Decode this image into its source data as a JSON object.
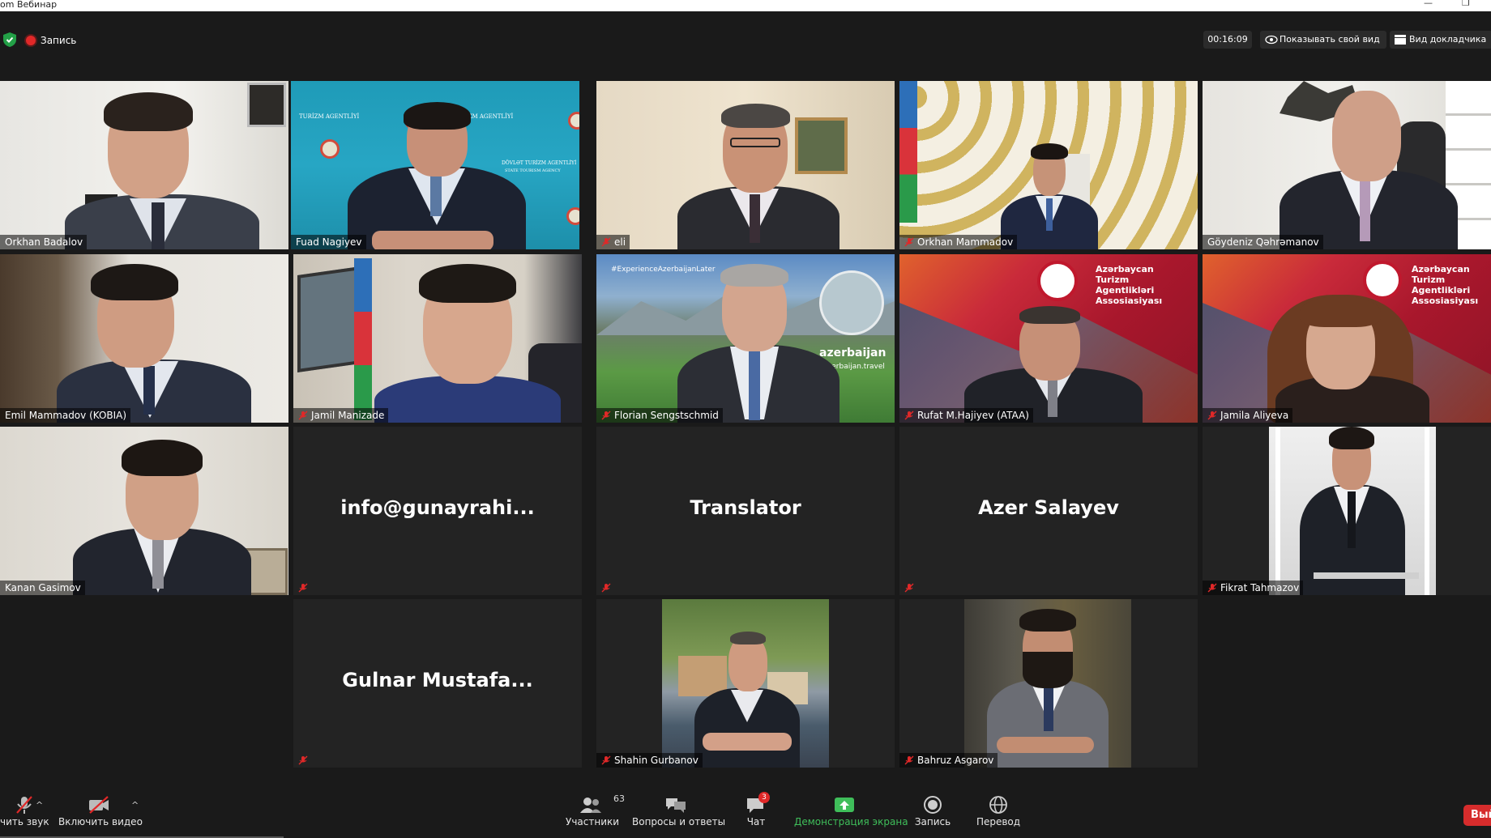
{
  "window": {
    "title": "om Вебинар"
  },
  "header": {
    "recording_label": "Запись",
    "timer": "00:16:09",
    "show_self_label": "Показывать свой вид",
    "speaker_view_label": "Вид докладчика"
  },
  "tiles": [
    {
      "name": "Orkhan Badalov",
      "muted": false,
      "video": true,
      "active": false
    },
    {
      "name": "Fuad Nagiyev",
      "muted": false,
      "video": true,
      "active": true
    },
    {
      "name": "eli",
      "muted": true,
      "video": true,
      "active": false
    },
    {
      "name": "Orkhan Mammadov",
      "muted": true,
      "video": true,
      "active": false
    },
    {
      "name": "Göydeniz Qəhrəmanov",
      "muted": false,
      "video": true,
      "active": false
    },
    {
      "name": "Emil Mammadov (KOBIA)",
      "muted": false,
      "video": true,
      "active": false
    },
    {
      "name": "Jamil Manizade",
      "muted": true,
      "video": true,
      "active": false
    },
    {
      "name": "Florian Sengstschmid",
      "muted": true,
      "video": true,
      "active": false
    },
    {
      "name": "Rufat M.Hajiyev (ATAA)",
      "muted": true,
      "video": true,
      "active": false
    },
    {
      "name": "Jamila Aliyeva",
      "muted": true,
      "video": true,
      "active": false
    },
    {
      "name": "Kanan Gasimov",
      "muted": false,
      "video": true,
      "active": false
    },
    {
      "name": "info@gunayrahi...",
      "muted": true,
      "video": false,
      "active": false
    },
    {
      "name": "Translator",
      "muted": true,
      "video": false,
      "active": false
    },
    {
      "name": "Azer Salayev",
      "muted": true,
      "video": false,
      "active": false
    },
    {
      "name": "Fikrat Tahmazov",
      "muted": true,
      "video": true,
      "active": false
    },
    {
      "name": "Gulnar Mustafa...",
      "muted": true,
      "video": false,
      "active": false
    },
    {
      "name": "Shahin Gurbanov",
      "muted": true,
      "video": true,
      "active": false
    },
    {
      "name": "Bahruz Asgarov",
      "muted": true,
      "video": true,
      "active": false
    }
  ],
  "overlays": {
    "tag_hashtag": "#ExperienceAzerbaijanLater",
    "brand_word": "azerbaijan",
    "brand_site": "azerbaijan.travel",
    "ataa_line1": "Azərbaycan",
    "ataa_line2": "Turizm",
    "ataa_line3": "Agentlikləri",
    "ataa_line4": "Assosiasiyası",
    "agency_text1": "DÖVLƏT TURİZM AGENTLİYİ",
    "agency_text2": "STATE TOURISM AGENCY",
    "agency_text3": "TURİZM AGENTLİYİ"
  },
  "toolbar": {
    "unmute_label": "чить звук",
    "video_label": "Включить видео",
    "participants_label": "Участники",
    "participants_count": "63",
    "qa_label": "Вопросы и ответы",
    "chat_label": "Чат",
    "chat_badge": "3",
    "share_label": "Демонстрация экрана",
    "record_label": "Запись",
    "translate_label": "Перевод",
    "leave_label": "Вый"
  },
  "colors": {
    "active_speaker": "#d6e033",
    "share_green": "#3fbe5a",
    "recording_red": "#e02828"
  }
}
